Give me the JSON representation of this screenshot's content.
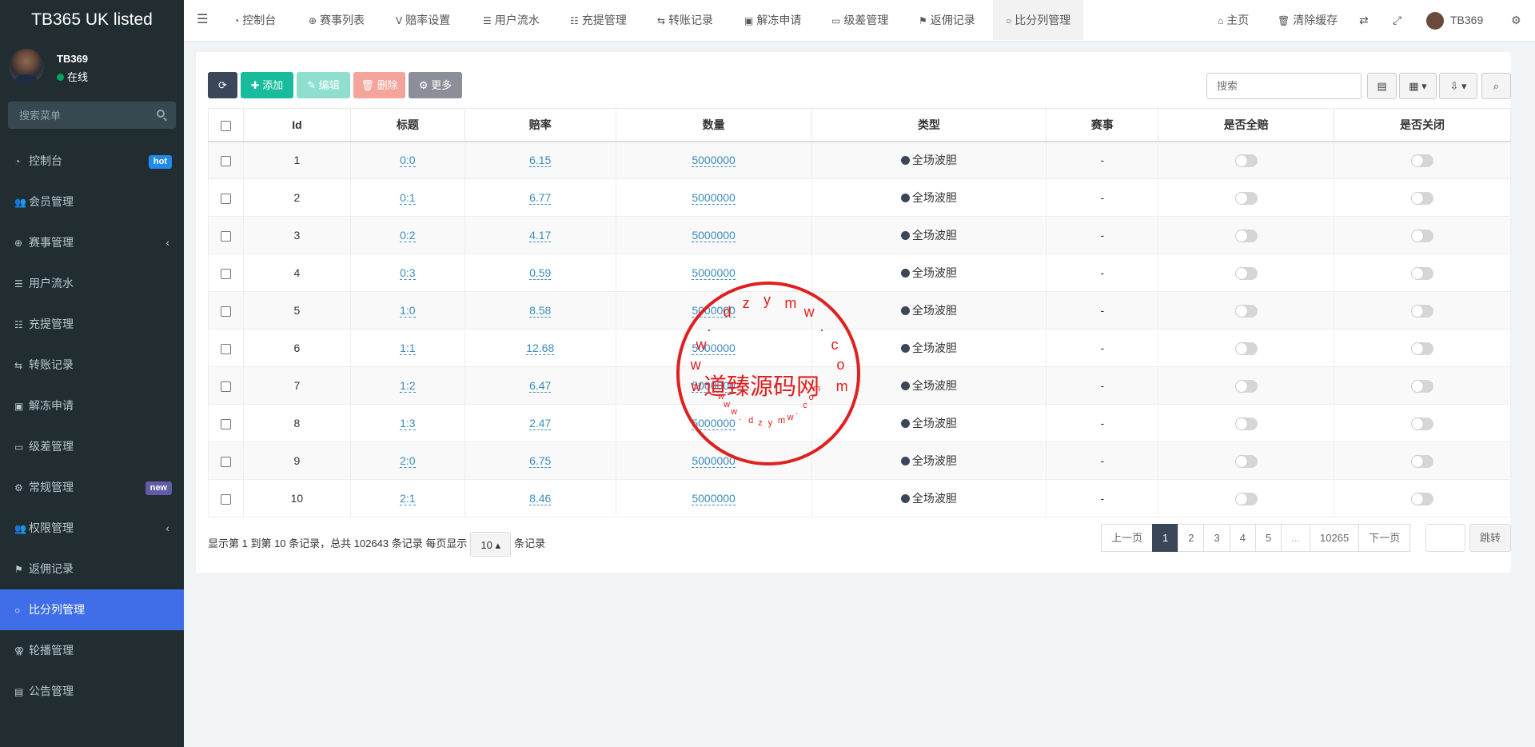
{
  "app": {
    "title": "TB365 UK listed"
  },
  "user": {
    "name": "TB369",
    "status": "在线"
  },
  "sidebar": {
    "search_placeholder": "搜索菜单",
    "items": [
      {
        "label": "控制台",
        "badge": "hot"
      },
      {
        "label": "会员管理"
      },
      {
        "label": "赛事管理"
      },
      {
        "label": "用户流水"
      },
      {
        "label": "充提管理"
      },
      {
        "label": "转账记录"
      },
      {
        "label": "解冻申请"
      },
      {
        "label": "级差管理"
      },
      {
        "label": "常规管理",
        "badge": "new"
      },
      {
        "label": "权限管理"
      },
      {
        "label": "返佣记录"
      },
      {
        "label": "比分列管理"
      },
      {
        "label": "轮播管理"
      },
      {
        "label": "公告管理"
      }
    ]
  },
  "topbar": {
    "tabs": [
      "控制台",
      "赛事列表",
      "赔率设置",
      "用户流水",
      "充提管理",
      "转账记录",
      "解冻申请",
      "级差管理",
      "返佣记录",
      "比分列管理"
    ],
    "home": "主页",
    "clear_cache": "清除缓存",
    "user": "TB369"
  },
  "toolbar": {
    "add": "添加",
    "edit": "编辑",
    "delete": "删除",
    "more": "更多",
    "search_placeholder": "搜索"
  },
  "table": {
    "headers": [
      "Id",
      "标题",
      "赔率",
      "数量",
      "类型",
      "赛事",
      "是否全赔",
      "是否关闭"
    ],
    "rows": [
      {
        "id": "1",
        "title": "0:0",
        "odds": "6.15",
        "qty": "5000000",
        "type": "全场波胆",
        "event": "-"
      },
      {
        "id": "2",
        "title": "0:1",
        "odds": "6.77",
        "qty": "5000000",
        "type": "全场波胆",
        "event": "-"
      },
      {
        "id": "3",
        "title": "0:2",
        "odds": "4.17",
        "qty": "5000000",
        "type": "全场波胆",
        "event": "-"
      },
      {
        "id": "4",
        "title": "0:3",
        "odds": "0.59",
        "qty": "5000000",
        "type": "全场波胆",
        "event": "-"
      },
      {
        "id": "5",
        "title": "1:0",
        "odds": "8.58",
        "qty": "5000000",
        "type": "全场波胆",
        "event": "-"
      },
      {
        "id": "6",
        "title": "1:1",
        "odds": "12.68",
        "qty": "5000000",
        "type": "全场波胆",
        "event": "-"
      },
      {
        "id": "7",
        "title": "1:2",
        "odds": "6.47",
        "qty": "5000000",
        "type": "全场波胆",
        "event": "-"
      },
      {
        "id": "8",
        "title": "1:3",
        "odds": "2.47",
        "qty": "5000000",
        "type": "全场波胆",
        "event": "-"
      },
      {
        "id": "9",
        "title": "2:0",
        "odds": "6.75",
        "qty": "5000000",
        "type": "全场波胆",
        "event": "-"
      },
      {
        "id": "10",
        "title": "2:1",
        "odds": "8.46",
        "qty": "5000000",
        "type": "全场波胆",
        "event": "-"
      }
    ]
  },
  "footer": {
    "summary": "显示第 1 到第 10 条记录，总共 102643 条记录 每页显示",
    "page_size": "10",
    "suffix": "条记录"
  },
  "pagination": {
    "prev": "上一页",
    "pages": [
      "1",
      "2",
      "3",
      "4",
      "5",
      "...",
      "10265"
    ],
    "next": "下一页",
    "jump": "跳转"
  },
  "watermark": {
    "text": "道臻源码网",
    "url_top": "www.dzymw.com",
    "url_bottom": "www.dzymw.com"
  }
}
